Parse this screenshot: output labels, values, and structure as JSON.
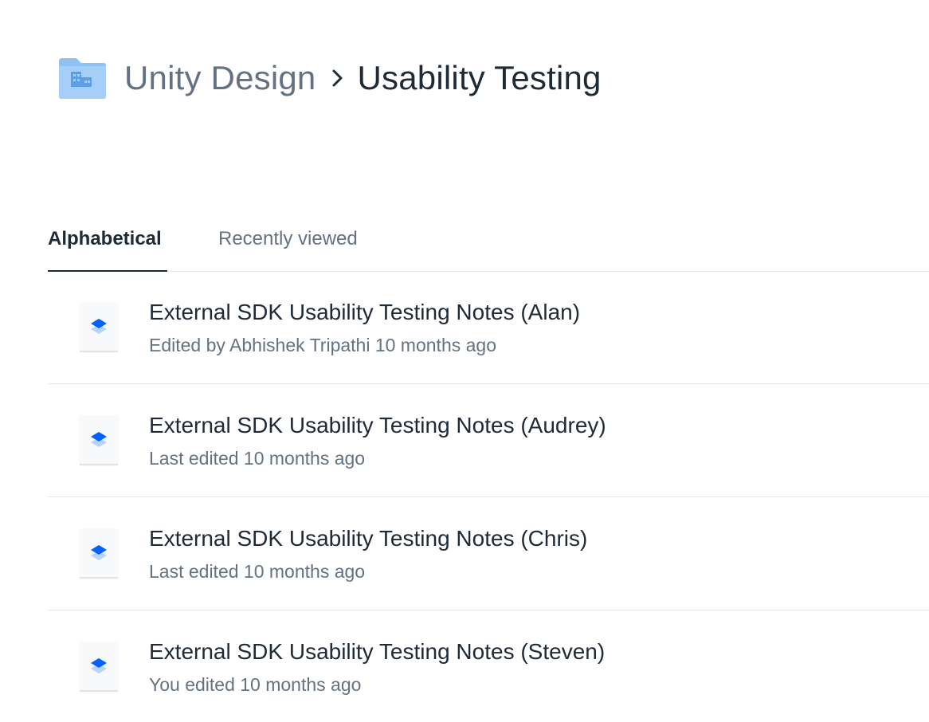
{
  "breadcrumb": {
    "parent": "Unity Design",
    "current": "Usability Testing",
    "folder_icon": "team-folder-icon",
    "separator_icon": "chevron-right-icon"
  },
  "tabs": [
    {
      "label": "Alphabetical",
      "active": true
    },
    {
      "label": "Recently viewed",
      "active": false
    }
  ],
  "documents": [
    {
      "title": "External SDK Usability Testing Notes (Alan)",
      "subtitle": "Edited by Abhishek Tripathi 10 months ago",
      "icon": "paper-doc-icon"
    },
    {
      "title": "External SDK Usability Testing Notes (Audrey)",
      "subtitle": "Last edited 10 months ago",
      "icon": "paper-doc-icon"
    },
    {
      "title": "External SDK Usability Testing Notes (Chris)",
      "subtitle": "Last edited 10 months ago",
      "icon": "paper-doc-icon"
    },
    {
      "title": "External SDK Usability Testing Notes (Steven)",
      "subtitle": "You edited 10 months ago",
      "icon": "paper-doc-icon"
    }
  ],
  "colors": {
    "accent": "#0061fe",
    "folder": "#90c2f5",
    "text_primary": "#1e2a36",
    "text_secondary": "#637282"
  }
}
